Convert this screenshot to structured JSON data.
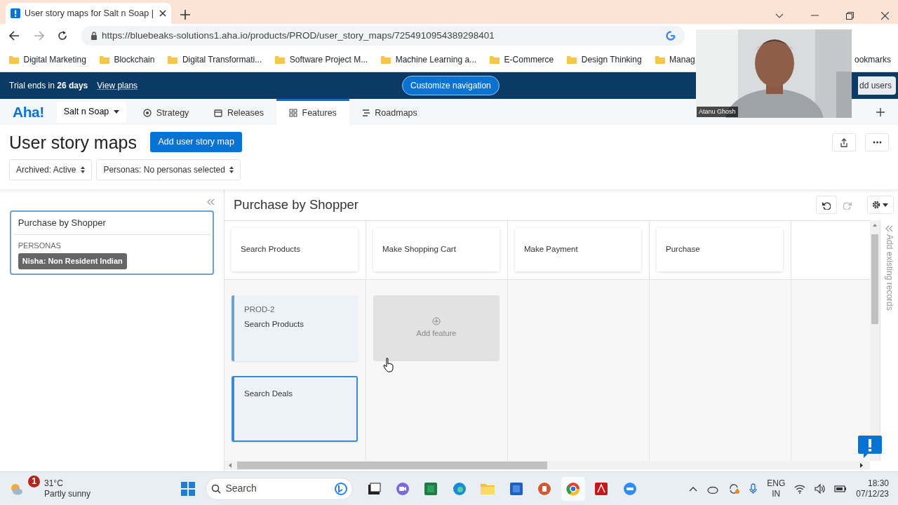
{
  "browser": {
    "tabs": [
      {
        "title": "User story maps for Salt n Soap |",
        "selected": true
      }
    ],
    "url": "https://bluebeaks-solutions1.aha.io/products/PROD/user_story_maps/7254910954389298401",
    "bookmarks": [
      {
        "label": "Digital Marketing",
        "kind": "folder"
      },
      {
        "label": "Blockchain",
        "kind": "folder"
      },
      {
        "label": "Digital Transformati...",
        "kind": "folder"
      },
      {
        "label": "Software Project M...",
        "kind": "folder"
      },
      {
        "label": "Machine Learning a...",
        "kind": "folder"
      },
      {
        "label": "E-Commerce",
        "kind": "folder"
      },
      {
        "label": "Design Thinking",
        "kind": "folder"
      },
      {
        "label": "Manag",
        "kind": "folder"
      },
      {
        "label": "ookmarks",
        "kind": "other"
      }
    ]
  },
  "trial": {
    "text": "Trial ends in **26 days**",
    "link": "View plans",
    "customize": "Customize navigation",
    "add_users": "dd users"
  },
  "nav": {
    "logo": "Aha!",
    "workspace": "Salt n Soap",
    "items": [
      {
        "label": "Strategy",
        "selected": false
      },
      {
        "label": "Releases",
        "selected": false
      },
      {
        "label": "Features",
        "selected": true
      },
      {
        "label": "Roadmaps",
        "selected": false
      }
    ]
  },
  "header": {
    "title": "User story maps",
    "add_button": "Add user story map",
    "filters": [
      "Archived: Active",
      "Personas: No personas selected"
    ]
  },
  "sidebar": {
    "maps": [
      {
        "title": "Purchase by Shopper",
        "personas_label": "PERSONAS",
        "personas": [
          "Nisha: Non Resident Indian"
        ],
        "selected": true
      }
    ]
  },
  "board": {
    "title": "Purchase by Shopper",
    "side_label": "Add existing records",
    "columns": [
      {
        "step": "Search Products",
        "cards": [
          {
            "kind": "feature",
            "ref": "PROD-2",
            "name": "Search Products",
            "selected": false
          },
          {
            "kind": "feature",
            "name": "Search Deals",
            "selected": true
          }
        ]
      },
      {
        "step": "Make Shopping Cart",
        "cards": [
          {
            "kind": "add",
            "name": "Add feature"
          }
        ]
      },
      {
        "step": "Make Payment"
      },
      {
        "step": "Purchase"
      }
    ]
  },
  "video": {
    "name": "Atanu Ghosh"
  },
  "taskbar": {
    "weather": {
      "badge": "1",
      "temp": "31°C",
      "desc": "Partly sunny"
    },
    "search_placeholder": "Search",
    "lang": [
      "ENG",
      "IN"
    ],
    "time": "18:30",
    "date": "07/12/23"
  }
}
